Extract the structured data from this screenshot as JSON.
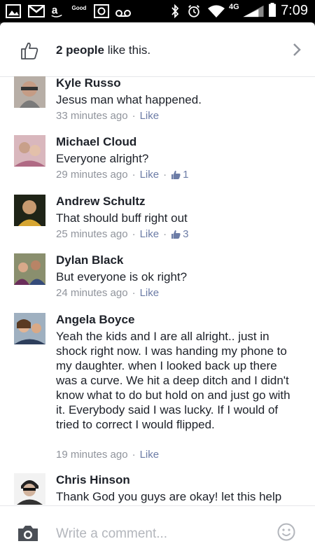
{
  "status_bar": {
    "good_label": "Good",
    "network": "4G",
    "time": "7:09"
  },
  "likes": {
    "count_text": "2 people",
    "suffix": " like this."
  },
  "comments": [
    {
      "name": "Kyle Russo",
      "text": "Jesus man what happened.",
      "time": "33 minutes ago",
      "like": "Like",
      "reactions": null
    },
    {
      "name": "Michael Cloud",
      "text": "Everyone alright?",
      "time": "29 minutes ago",
      "like": "Like",
      "reactions": "1"
    },
    {
      "name": "Andrew Schultz",
      "text": "That should buff right out",
      "time": "25 minutes ago",
      "like": "Like",
      "reactions": "3"
    },
    {
      "name": "Dylan Black",
      "text": "But everyone is ok right?",
      "time": "24 minutes ago",
      "like": "Like",
      "reactions": null
    },
    {
      "name": "Angela Boyce",
      "text": "Yeah the kids and I are all alright.. just in shock right now.  I was handing my phone to my daughter.  when I looked back up there was a curve. We hit a deep ditch and I didn't  know what to do but hold on and just go with it. Everybody said I was lucky.  If I would of tried to correct I would flipped.",
      "time": "19 minutes ago",
      "like": "Like",
      "reactions": null
    },
    {
      "name": "Chris Hinson",
      "text": "Thank God you guys are okay! let this help",
      "time": "",
      "like": "",
      "reactions": null
    }
  ],
  "composer": {
    "placeholder": "Write a comment..."
  },
  "colors": {
    "text": "#1d2129",
    "meta": "#90949c",
    "link": "#6c7ca6"
  },
  "icons": [
    "thumbs-up-icon",
    "chevron-right-icon",
    "camera-icon",
    "smiley-icon"
  ]
}
